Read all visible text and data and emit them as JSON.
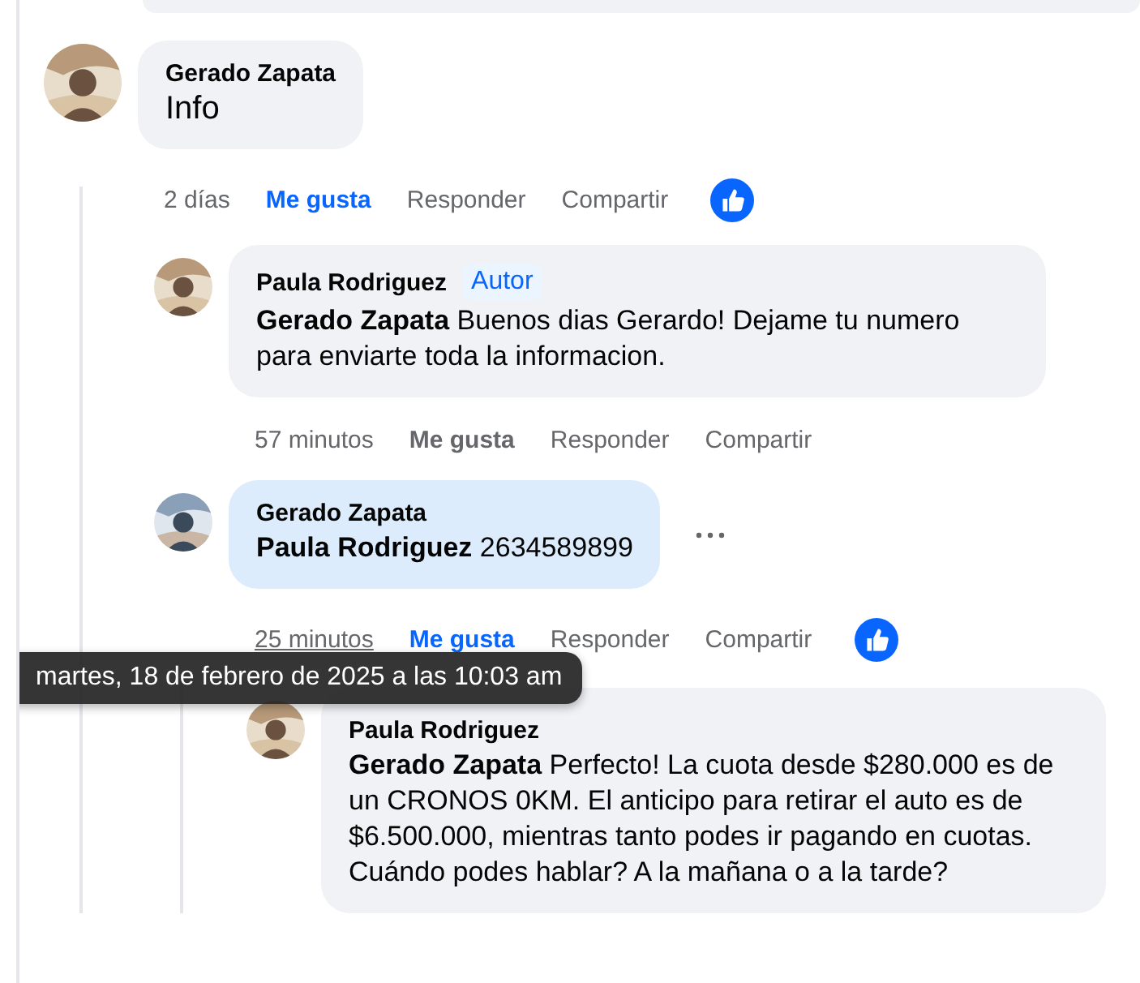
{
  "comments": [
    {
      "author": "Gerado Zapata",
      "text": "Info",
      "time": "2 días",
      "time_hovered": false,
      "like_label": "Me gusta",
      "liked": true,
      "reply_label": "Responder",
      "share_label": "Compartir",
      "has_reaction": true,
      "highlighted": false,
      "replies": [
        {
          "author": "Paula Rodriguez",
          "badge": "Autor",
          "text": "**Gerado Zapata** Buenos dias Gerardo! Dejame tu numero para enviarte toda la informacion.",
          "time": "57 minutos",
          "time_hovered": false,
          "like_label": "Me gusta",
          "liked": false,
          "reply_label": "Responder",
          "share_label": "Compartir",
          "highlighted": false
        },
        {
          "author": "Gerado Zapata",
          "text": "**Paula Rodriguez** 2634589899",
          "time": "25 minutos",
          "time_hovered": true,
          "like_label": "Me gusta",
          "liked": true,
          "reply_label": "Responder",
          "share_label": "Compartir",
          "has_reaction": true,
          "highlighted": true,
          "show_more": true,
          "replies": [
            {
              "author": "Paula Rodriguez",
              "text": "**Gerado Zapata** Perfecto! La cuota desde $280.000 es de un CRONOS 0KM. El anticipo para retirar el auto es de $6.500.000, mientras tanto podes ir pagando en cuotas. Cuándo podes hablar? A la mañana o a la tarde?",
              "highlighted": false
            }
          ]
        }
      ]
    }
  ],
  "tooltip": {
    "text": "martes, 18 de febrero de 2025 a las 10:03 am"
  }
}
